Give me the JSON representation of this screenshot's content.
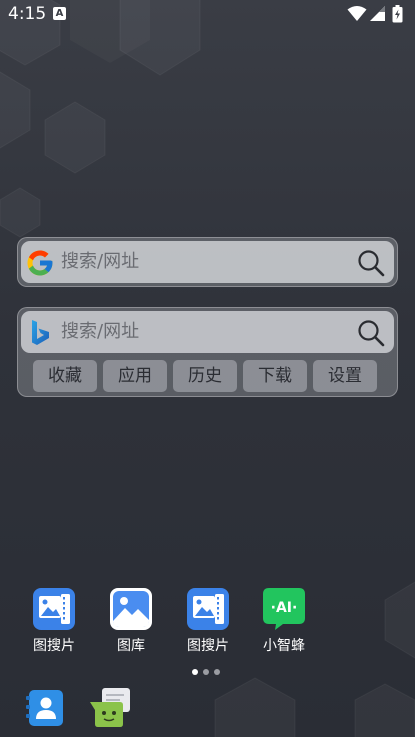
{
  "status_bar": {
    "time": "4:15",
    "notification_glyph": "A",
    "icons": [
      "wifi-icon",
      "signal-icon",
      "battery-icon"
    ]
  },
  "widgets": {
    "google_search": {
      "logo": "google-logo-icon",
      "placeholder": "搜索/网址",
      "search_icon": "search-icon"
    },
    "bing_search": {
      "logo": "bing-logo-icon",
      "placeholder": "搜索/网址",
      "search_icon": "search-icon",
      "shortcuts": [
        "收藏",
        "应用",
        "历史",
        "下载",
        "设置"
      ]
    }
  },
  "home_apps": [
    {
      "label": "图搜片",
      "icon": "image-search-app-icon"
    },
    {
      "label": "图库",
      "icon": "gallery-app-icon"
    },
    {
      "label": "图搜片",
      "icon": "image-search-app-icon"
    },
    {
      "label": "小智蜂",
      "icon": "ai-assistant-app-icon",
      "icon_text": "·AI·"
    }
  ],
  "page_indicator": {
    "total": 3,
    "active": 0
  },
  "dock_apps": [
    {
      "icon": "contacts-app-icon"
    },
    {
      "icon": "messages-app-icon"
    }
  ],
  "colors": {
    "wallpaper_top": "#3a3d45",
    "wallpaper_bottom": "#2a2d35",
    "app_blue": "#3b82e8",
    "ai_green": "#22c55e",
    "messages_green": "#8bc34a"
  }
}
